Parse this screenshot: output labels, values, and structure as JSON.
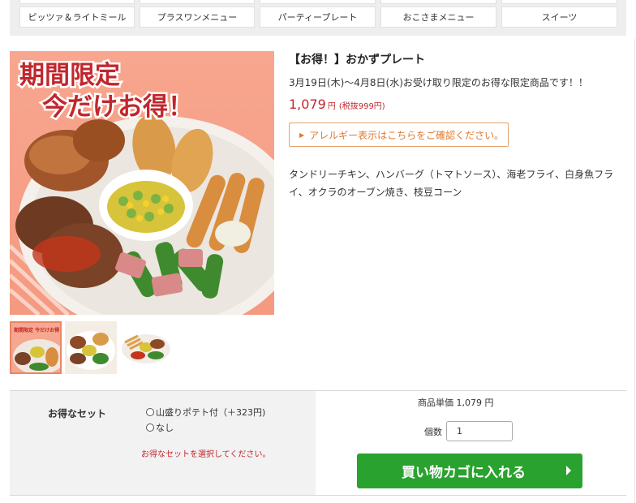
{
  "nav": {
    "items": [
      "ピッツァ＆ライトミール",
      "プラスワンメニュー",
      "パーティープレート",
      "おこさまメニュー",
      "スイーツ"
    ]
  },
  "hero": {
    "banner_line1": "期間限定",
    "banner_line2": "今だけお得！",
    "thumb_banner": "期間限定 今だけお得！"
  },
  "product": {
    "title": "【お得！】おかずプレート",
    "description": "3月19日(木)〜4月8日(水)お受け取り限定のお得な限定商品です！！",
    "price": "1,079",
    "price_unit": "円",
    "tax_note": "(税抜999円)",
    "allergy_link": "アレルギー表示はこちらをご確認ください。",
    "ingredients": "タンドリーチキン、ハンバーグ（トマトソース）、海老フライ、白身魚フライ、オクラのオーブン焼き、枝豆コーン"
  },
  "cart": {
    "set_label": "お得なセット",
    "option_potato": "山盛りポテト付（＋323円)",
    "option_none": "なし",
    "set_warning": "お得なセットを選択してください。",
    "unit_price_label": "商品単価 1,079 円",
    "quantity_label": "個数",
    "quantity_value": "1",
    "add_to_cart": "買い物カゴに入れる"
  },
  "colors": {
    "price_red": "#c0272d",
    "allergy_orange": "#e07a2f",
    "cart_green": "#2aa22f"
  }
}
